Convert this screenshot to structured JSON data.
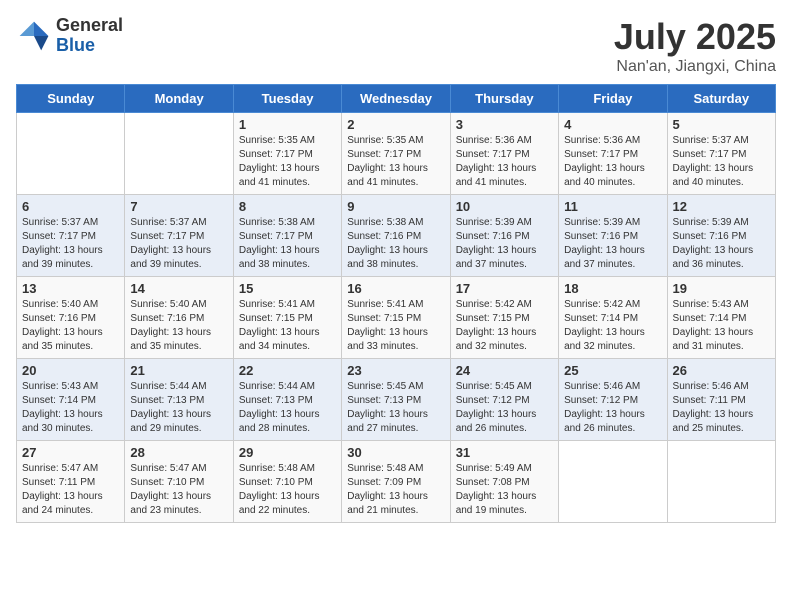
{
  "header": {
    "logo_general": "General",
    "logo_blue": "Blue",
    "month_title": "July 2025",
    "location": "Nan'an, Jiangxi, China"
  },
  "weekdays": [
    "Sunday",
    "Monday",
    "Tuesday",
    "Wednesday",
    "Thursday",
    "Friday",
    "Saturday"
  ],
  "weeks": [
    [
      {
        "day": "",
        "detail": ""
      },
      {
        "day": "",
        "detail": ""
      },
      {
        "day": "1",
        "detail": "Sunrise: 5:35 AM\nSunset: 7:17 PM\nDaylight: 13 hours and 41 minutes."
      },
      {
        "day": "2",
        "detail": "Sunrise: 5:35 AM\nSunset: 7:17 PM\nDaylight: 13 hours and 41 minutes."
      },
      {
        "day": "3",
        "detail": "Sunrise: 5:36 AM\nSunset: 7:17 PM\nDaylight: 13 hours and 41 minutes."
      },
      {
        "day": "4",
        "detail": "Sunrise: 5:36 AM\nSunset: 7:17 PM\nDaylight: 13 hours and 40 minutes."
      },
      {
        "day": "5",
        "detail": "Sunrise: 5:37 AM\nSunset: 7:17 PM\nDaylight: 13 hours and 40 minutes."
      }
    ],
    [
      {
        "day": "6",
        "detail": "Sunrise: 5:37 AM\nSunset: 7:17 PM\nDaylight: 13 hours and 39 minutes."
      },
      {
        "day": "7",
        "detail": "Sunrise: 5:37 AM\nSunset: 7:17 PM\nDaylight: 13 hours and 39 minutes."
      },
      {
        "day": "8",
        "detail": "Sunrise: 5:38 AM\nSunset: 7:17 PM\nDaylight: 13 hours and 38 minutes."
      },
      {
        "day": "9",
        "detail": "Sunrise: 5:38 AM\nSunset: 7:16 PM\nDaylight: 13 hours and 38 minutes."
      },
      {
        "day": "10",
        "detail": "Sunrise: 5:39 AM\nSunset: 7:16 PM\nDaylight: 13 hours and 37 minutes."
      },
      {
        "day": "11",
        "detail": "Sunrise: 5:39 AM\nSunset: 7:16 PM\nDaylight: 13 hours and 37 minutes."
      },
      {
        "day": "12",
        "detail": "Sunrise: 5:39 AM\nSunset: 7:16 PM\nDaylight: 13 hours and 36 minutes."
      }
    ],
    [
      {
        "day": "13",
        "detail": "Sunrise: 5:40 AM\nSunset: 7:16 PM\nDaylight: 13 hours and 35 minutes."
      },
      {
        "day": "14",
        "detail": "Sunrise: 5:40 AM\nSunset: 7:16 PM\nDaylight: 13 hours and 35 minutes."
      },
      {
        "day": "15",
        "detail": "Sunrise: 5:41 AM\nSunset: 7:15 PM\nDaylight: 13 hours and 34 minutes."
      },
      {
        "day": "16",
        "detail": "Sunrise: 5:41 AM\nSunset: 7:15 PM\nDaylight: 13 hours and 33 minutes."
      },
      {
        "day": "17",
        "detail": "Sunrise: 5:42 AM\nSunset: 7:15 PM\nDaylight: 13 hours and 32 minutes."
      },
      {
        "day": "18",
        "detail": "Sunrise: 5:42 AM\nSunset: 7:14 PM\nDaylight: 13 hours and 32 minutes."
      },
      {
        "day": "19",
        "detail": "Sunrise: 5:43 AM\nSunset: 7:14 PM\nDaylight: 13 hours and 31 minutes."
      }
    ],
    [
      {
        "day": "20",
        "detail": "Sunrise: 5:43 AM\nSunset: 7:14 PM\nDaylight: 13 hours and 30 minutes."
      },
      {
        "day": "21",
        "detail": "Sunrise: 5:44 AM\nSunset: 7:13 PM\nDaylight: 13 hours and 29 minutes."
      },
      {
        "day": "22",
        "detail": "Sunrise: 5:44 AM\nSunset: 7:13 PM\nDaylight: 13 hours and 28 minutes."
      },
      {
        "day": "23",
        "detail": "Sunrise: 5:45 AM\nSunset: 7:13 PM\nDaylight: 13 hours and 27 minutes."
      },
      {
        "day": "24",
        "detail": "Sunrise: 5:45 AM\nSunset: 7:12 PM\nDaylight: 13 hours and 26 minutes."
      },
      {
        "day": "25",
        "detail": "Sunrise: 5:46 AM\nSunset: 7:12 PM\nDaylight: 13 hours and 26 minutes."
      },
      {
        "day": "26",
        "detail": "Sunrise: 5:46 AM\nSunset: 7:11 PM\nDaylight: 13 hours and 25 minutes."
      }
    ],
    [
      {
        "day": "27",
        "detail": "Sunrise: 5:47 AM\nSunset: 7:11 PM\nDaylight: 13 hours and 24 minutes."
      },
      {
        "day": "28",
        "detail": "Sunrise: 5:47 AM\nSunset: 7:10 PM\nDaylight: 13 hours and 23 minutes."
      },
      {
        "day": "29",
        "detail": "Sunrise: 5:48 AM\nSunset: 7:10 PM\nDaylight: 13 hours and 22 minutes."
      },
      {
        "day": "30",
        "detail": "Sunrise: 5:48 AM\nSunset: 7:09 PM\nDaylight: 13 hours and 21 minutes."
      },
      {
        "day": "31",
        "detail": "Sunrise: 5:49 AM\nSunset: 7:08 PM\nDaylight: 13 hours and 19 minutes."
      },
      {
        "day": "",
        "detail": ""
      },
      {
        "day": "",
        "detail": ""
      }
    ]
  ]
}
